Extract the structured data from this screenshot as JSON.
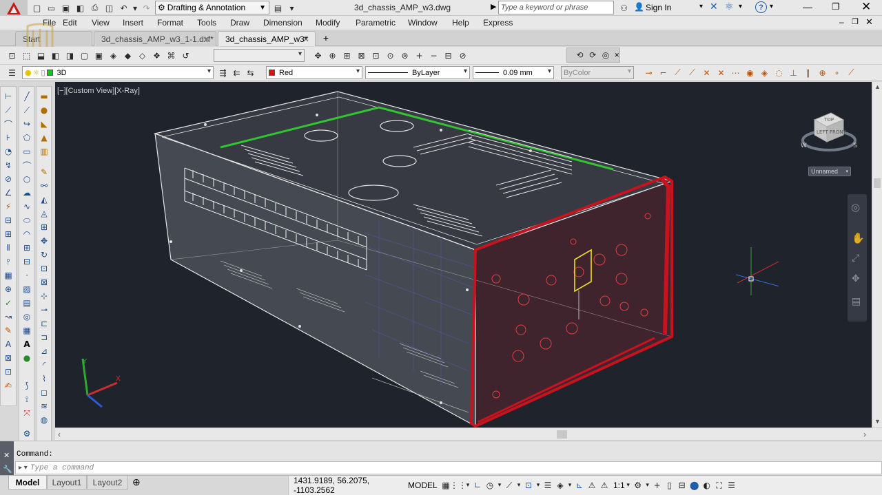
{
  "titlebar": {
    "workspace": "Drafting & Annotation",
    "file_title": "3d_chassis_AMP_w3.dwg",
    "search_placeholder": "Type a keyword or phrase",
    "sign_in": "Sign In"
  },
  "menu": [
    "File",
    "Edit",
    "View",
    "Insert",
    "Format",
    "Tools",
    "Draw",
    "Dimension",
    "Modify",
    "Parametric",
    "Window",
    "Help",
    "Express"
  ],
  "tabs": [
    {
      "label": "Start",
      "active": false
    },
    {
      "label": "3d_chassis_AMP_w3_1-1.dxf*",
      "active": false
    },
    {
      "label": "3d_chassis_AMP_w3*",
      "active": true
    }
  ],
  "properties_bar": {
    "layer": "3D",
    "color": "Red",
    "color_hex": "#e01010",
    "linetype": "ByLayer",
    "lineweight": "0.09 mm",
    "plotstyle": "ByColor"
  },
  "viewport": {
    "label": "[−][Custom View][X-Ray]",
    "background": "#1f232c",
    "viewcube_top": "TOP",
    "viewcube_front": "LEFT",
    "viewcube_right": "FRONT",
    "compass_w": "W",
    "compass_s": "S",
    "ucs_name": "Unnamed",
    "ucs_x": "X",
    "ucs_y": "Y"
  },
  "command": {
    "history": "Command:",
    "placeholder": "Type a command"
  },
  "layout_tabs": [
    "Model",
    "Layout1",
    "Layout2"
  ],
  "status": {
    "coordinates": "1431.9189, 56.2075, -1103.2562",
    "space": "MODEL",
    "scale": "1:1"
  }
}
